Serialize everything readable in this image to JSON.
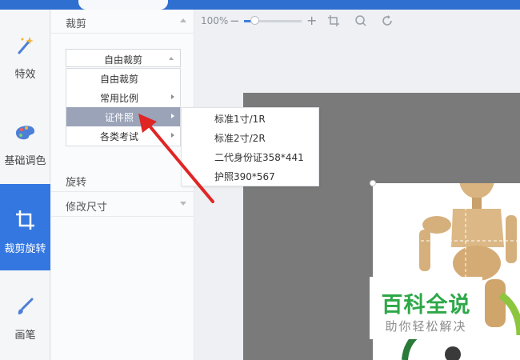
{
  "panel": {
    "crop_header": "裁剪",
    "select_value": "自由裁剪",
    "dropdown_items": [
      "自由裁剪",
      "常用比例",
      "证件照",
      "各类考试"
    ],
    "submenu_items": [
      "标准1寸/1R",
      "标准2寸/2R",
      "二代身份证358*441",
      "护照390*567"
    ],
    "rotate_header": "旋转",
    "resize_header": "修改尺寸"
  },
  "rail": {
    "effects": "特效",
    "basic": "基础调色",
    "crop_rotate": "裁剪旋转",
    "brush": "画笔"
  },
  "toolbar": {
    "zoom": "100%",
    "minus": "−",
    "plus": "+",
    "zoom_level": 0.2
  },
  "watermark": {
    "main": "百科全说",
    "sub": "助你轻松解决"
  },
  "colors": {
    "accent": "#3477e0",
    "highlight": "#9aa3b8",
    "watermark_green": "#2da848",
    "arrow_red": "#e02525"
  },
  "icons": [
    "magic-wand-icon",
    "palette-icon",
    "crop-icon",
    "brush-icon",
    "crop-tool-icon",
    "zoom-icon",
    "rotate-icon"
  ]
}
